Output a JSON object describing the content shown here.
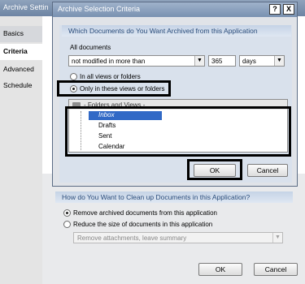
{
  "background_window": {
    "title": "Archive Settin",
    "tabs": [
      "Basics",
      "Criteria",
      "Advanced",
      "Schedule"
    ],
    "active_tab": "Criteria",
    "section2": {
      "header": "How do You Want to Clean up Documents in this Application?",
      "option1": "Remove archived documents from this application",
      "option2": "Reduce the size of documents in this application",
      "reduce_select": "Remove attachments, leave summary"
    },
    "ok_label": "OK",
    "cancel_label": "Cancel"
  },
  "dialog": {
    "title": "Archive Selection Criteria",
    "help_label": "?",
    "close_label": "X",
    "section1_header": "Which Documents do You Want Archived from this Application",
    "all_documents_label": "All documents",
    "condition_select": "not modified in more than",
    "days_value": "365",
    "unit_select": "days",
    "option_all_views": "In all views or folders",
    "option_only_these": "Only in these views or folders",
    "list_header": "- Folders and Views -",
    "folders": [
      "Inbox",
      "Drafts",
      "Sent",
      "Calendar"
    ],
    "selected_folder": "Inbox",
    "ok_label": "OK",
    "cancel_label": "Cancel"
  }
}
